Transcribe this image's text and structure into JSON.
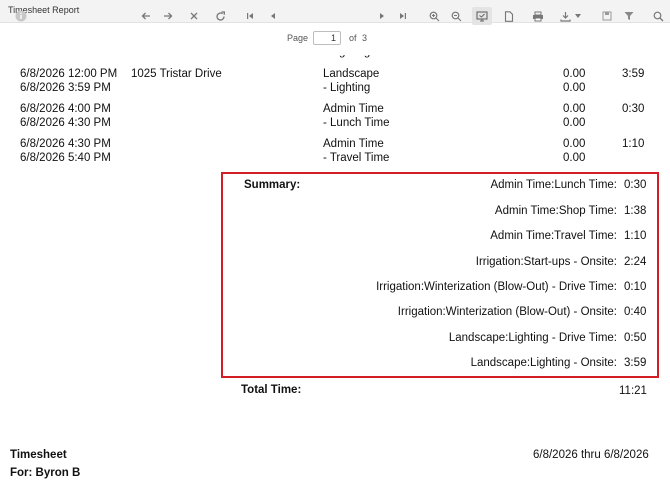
{
  "window": {
    "title": "Timesheet Report"
  },
  "toolbar": {
    "icons": [
      "info-icon",
      "back-icon",
      "forward-icon",
      "stop-icon",
      "refresh-icon",
      "first-page-icon",
      "prev-page-icon",
      "next-page-icon",
      "last-page-icon",
      "zoom-in-icon",
      "zoom-out-icon",
      "view-icon",
      "page-icon",
      "print-icon",
      "export-icon",
      "caret-icon",
      "save-icon",
      "filter-icon",
      "search-icon"
    ],
    "page_label": "Page",
    "page_value": "1",
    "of_label": "of",
    "page_total": "3"
  },
  "rows": [
    {
      "start": "6/8/2026 12:00 PM",
      "end": "6/8/2026 3:59 PM",
      "location": "1025 Tristar Drive",
      "category": "Landscape",
      "subcategory": "- Lighting",
      "v1": "0.00",
      "v2": "0.00",
      "duration": "3:59"
    },
    {
      "start": "6/8/2026 4:00 PM",
      "end": "6/8/2026 4:30 PM",
      "location": "",
      "category": "Admin Time",
      "subcategory": "- Lunch Time",
      "v1": "0.00",
      "v2": "0.00",
      "duration": "0:30"
    },
    {
      "start": "6/8/2026 4:30 PM",
      "end": "6/8/2026 5:40 PM",
      "location": "",
      "category": "Admin Time",
      "subcategory": "- Travel Time",
      "v1": "0.00",
      "v2": "0.00",
      "duration": "1:10"
    }
  ],
  "summary": {
    "label": "Summary:",
    "items": [
      {
        "name": "Admin Time:Lunch Time:",
        "value": "0:30"
      },
      {
        "name": "Admin Time:Shop Time:",
        "value": "1:38"
      },
      {
        "name": "Admin Time:Travel Time:",
        "value": "1:10"
      },
      {
        "name": "Irrigation:Start-ups - Onsite:",
        "value": "2:24"
      },
      {
        "name": "Irrigation:Winterization (Blow-Out) - Drive Time:",
        "value": "0:10"
      },
      {
        "name": "Irrigation:Winterization (Blow-Out) - Onsite:",
        "value": "0:40"
      },
      {
        "name": "Landscape:Lighting - Drive Time:",
        "value": "0:50"
      },
      {
        "name": "Landscape:Lighting - Onsite:",
        "value": "3:59"
      }
    ]
  },
  "total": {
    "label": "Total Time:",
    "value": "11:21"
  },
  "footer": {
    "title": "Timesheet",
    "for": "For: Byron B",
    "range": "6/8/2026 thru 6/8/2026"
  },
  "colors": {
    "highlight": "#d21f26"
  }
}
